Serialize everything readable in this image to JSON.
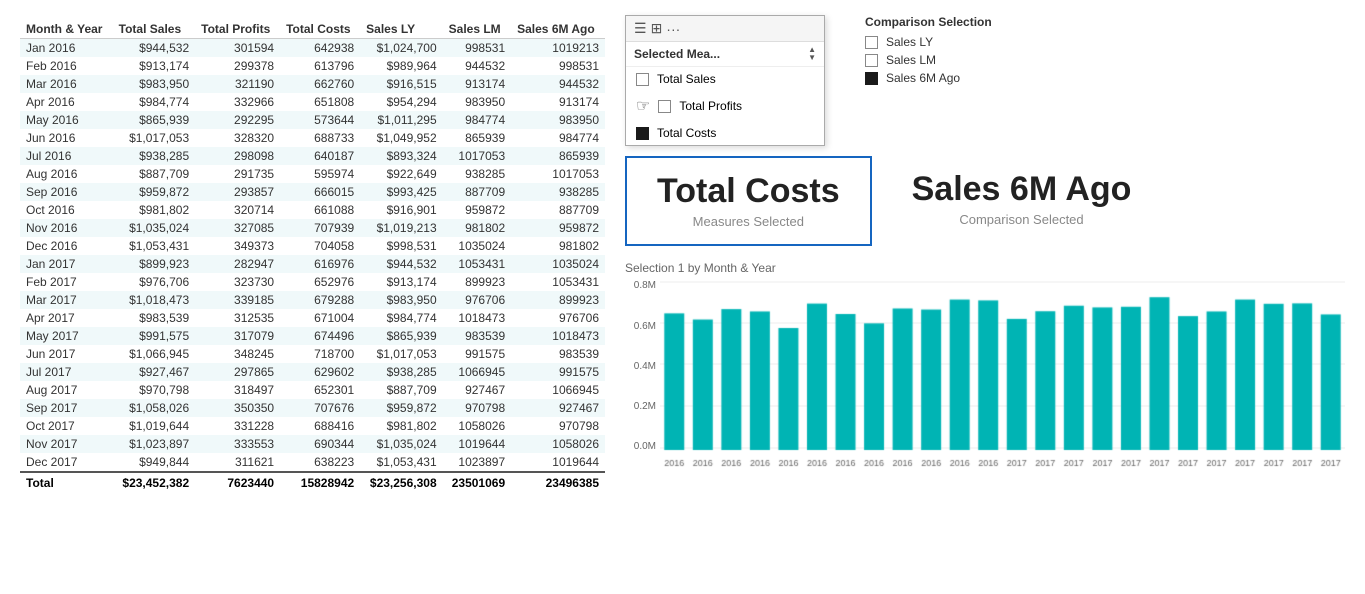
{
  "table": {
    "headers": [
      "Month & Year",
      "Total Sales",
      "Total Profits",
      "Total Costs",
      "Sales LY",
      "Sales LM",
      "Sales 6M Ago"
    ],
    "rows": [
      [
        "Jan 2016",
        "$944,532",
        "301594",
        "642938",
        "$1,024,700",
        "998531",
        "1019213"
      ],
      [
        "Feb 2016",
        "$913,174",
        "299378",
        "613796",
        "$989,964",
        "944532",
        "998531"
      ],
      [
        "Mar 2016",
        "$983,950",
        "321190",
        "662760",
        "$916,515",
        "913174",
        "944532"
      ],
      [
        "Apr 2016",
        "$984,774",
        "332966",
        "651808",
        "$954,294",
        "983950",
        "913174"
      ],
      [
        "May 2016",
        "$865,939",
        "292295",
        "573644",
        "$1,011,295",
        "984774",
        "983950"
      ],
      [
        "Jun 2016",
        "$1,017,053",
        "328320",
        "688733",
        "$1,049,952",
        "865939",
        "984774"
      ],
      [
        "Jul 2016",
        "$938,285",
        "298098",
        "640187",
        "$893,324",
        "1017053",
        "865939"
      ],
      [
        "Aug 2016",
        "$887,709",
        "291735",
        "595974",
        "$922,649",
        "938285",
        "1017053"
      ],
      [
        "Sep 2016",
        "$959,872",
        "293857",
        "666015",
        "$993,425",
        "887709",
        "938285"
      ],
      [
        "Oct 2016",
        "$981,802",
        "320714",
        "661088",
        "$916,901",
        "959872",
        "887709"
      ],
      [
        "Nov 2016",
        "$1,035,024",
        "327085",
        "707939",
        "$1,019,213",
        "981802",
        "959872"
      ],
      [
        "Dec 2016",
        "$1,053,431",
        "349373",
        "704058",
        "$998,531",
        "1035024",
        "981802"
      ],
      [
        "Jan 2017",
        "$899,923",
        "282947",
        "616976",
        "$944,532",
        "1053431",
        "1035024"
      ],
      [
        "Feb 2017",
        "$976,706",
        "323730",
        "652976",
        "$913,174",
        "899923",
        "1053431"
      ],
      [
        "Mar 2017",
        "$1,018,473",
        "339185",
        "679288",
        "$983,950",
        "976706",
        "899923"
      ],
      [
        "Apr 2017",
        "$983,539",
        "312535",
        "671004",
        "$984,774",
        "1018473",
        "976706"
      ],
      [
        "May 2017",
        "$991,575",
        "317079",
        "674496",
        "$865,939",
        "983539",
        "1018473"
      ],
      [
        "Jun 2017",
        "$1,066,945",
        "348245",
        "718700",
        "$1,017,053",
        "991575",
        "983539"
      ],
      [
        "Jul 2017",
        "$927,467",
        "297865",
        "629602",
        "$938,285",
        "1066945",
        "991575"
      ],
      [
        "Aug 2017",
        "$970,798",
        "318497",
        "652301",
        "$887,709",
        "927467",
        "1066945"
      ],
      [
        "Sep 2017",
        "$1,058,026",
        "350350",
        "707676",
        "$959,872",
        "970798",
        "927467"
      ],
      [
        "Oct 2017",
        "$1,019,644",
        "331228",
        "688416",
        "$981,802",
        "1058026",
        "970798"
      ],
      [
        "Nov 2017",
        "$1,023,897",
        "333553",
        "690344",
        "$1,035,024",
        "1019644",
        "1058026"
      ],
      [
        "Dec 2017",
        "$949,844",
        "311621",
        "638223",
        "$1,053,431",
        "1023897",
        "1019644"
      ]
    ],
    "footer": [
      "Total",
      "$23,452,382",
      "7623440",
      "15828942",
      "$23,256,308",
      "23501069",
      "23496385"
    ]
  },
  "dropdown": {
    "title": "Selected Mea...",
    "items": [
      {
        "label": "Total Sales",
        "checked": false
      },
      {
        "label": "Total Profits",
        "checked": false
      },
      {
        "label": "Total Costs",
        "checked": true
      }
    ]
  },
  "comparison": {
    "title": "Comparison Selection",
    "items": [
      {
        "label": "Sales LY",
        "checked": false
      },
      {
        "label": "Sales LM",
        "checked": false
      },
      {
        "label": "Sales 6M Ago",
        "checked": true
      }
    ]
  },
  "kpi": {
    "measure": {
      "value": "Total Costs",
      "label": "Measures Selected"
    },
    "comparison": {
      "value": "Sales 6M Ago",
      "label": "Comparison Selected"
    }
  },
  "chart": {
    "title": "Selection 1 by Month & Year",
    "yLabels": [
      "0.8M",
      "0.6M",
      "0.4M",
      "0.2M",
      "0.0M"
    ],
    "bars": [
      0.643,
      0.614,
      0.663,
      0.652,
      0.574,
      0.689,
      0.64,
      0.596,
      0.666,
      0.661,
      0.708,
      0.704,
      0.617,
      0.653,
      0.679,
      0.671,
      0.674,
      0.719,
      0.63,
      0.652,
      0.708,
      0.688,
      0.69,
      0.638
    ],
    "xLabels": [
      "2016",
      "2016",
      "2016",
      "2016",
      "2016",
      "2016",
      "2016",
      "2016",
      "2016",
      "2016",
      "2016",
      "2016",
      "2017",
      "2017",
      "2017",
      "2017",
      "2017",
      "2017",
      "2017",
      "2017",
      "2017",
      "2017",
      "2017",
      "2017"
    ],
    "color": "#00b4b4",
    "maxValue": 0.8
  }
}
